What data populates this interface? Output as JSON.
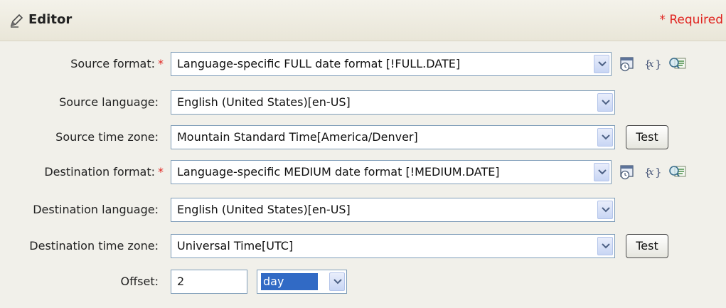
{
  "header": {
    "title": "Editor",
    "required_note": "* Required",
    "icon": "pencil-icon"
  },
  "fields": {
    "source_format": {
      "label": "Source format:",
      "required_mark": "*",
      "value": "Language-specific FULL date format [!FULL.DATE]"
    },
    "source_language": {
      "label": "Source language:",
      "value": "English (United States)[en-US]"
    },
    "source_time_zone": {
      "label": "Source time zone:",
      "value": "Mountain Standard Time[America/Denver]",
      "test_label": "Test"
    },
    "destination_format": {
      "label": "Destination format:",
      "required_mark": "*",
      "value": "Language-specific MEDIUM date format [!MEDIUM.DATE]"
    },
    "destination_language": {
      "label": "Destination language:",
      "value": "English (United States)[en-US]"
    },
    "destination_time_zone": {
      "label": "Destination time zone:",
      "value": "Universal Time[UTC]",
      "test_label": "Test"
    },
    "offset": {
      "label": "Offset:",
      "value": "2",
      "unit": "day"
    }
  },
  "toolbar_icons": [
    "date-format-icon",
    "variable-icon",
    "browse-search-icon"
  ],
  "colors": {
    "required": "#e0231f",
    "selection": "#316ac5",
    "border": "#7f9db9"
  }
}
